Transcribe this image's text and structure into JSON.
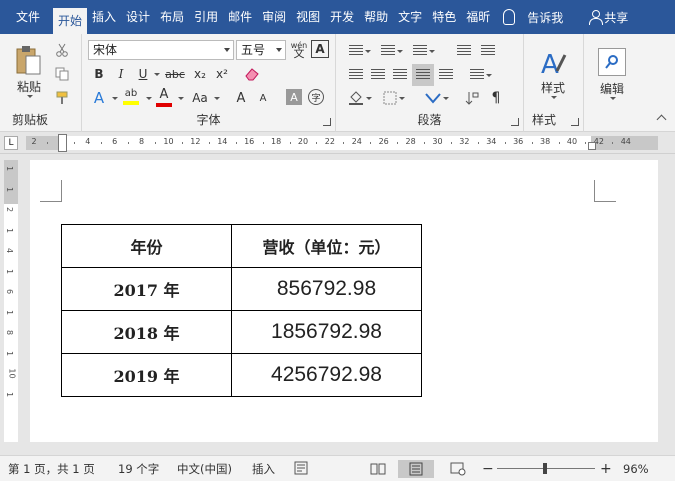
{
  "tabs": [
    {
      "label": "文件",
      "active": false
    },
    {
      "label": "开始",
      "active": true
    },
    {
      "label": "插入",
      "active": false
    },
    {
      "label": "设计",
      "active": false
    },
    {
      "label": "布局",
      "active": false
    },
    {
      "label": "引用",
      "active": false
    },
    {
      "label": "邮件",
      "active": false
    },
    {
      "label": "审阅",
      "active": false
    },
    {
      "label": "视图",
      "active": false
    },
    {
      "label": "开发",
      "active": false
    },
    {
      "label": "帮助",
      "active": false
    },
    {
      "label": "文字",
      "active": false
    },
    {
      "label": "特色",
      "active": false
    },
    {
      "label": "福昕",
      "active": false
    }
  ],
  "tell_me": "告诉我",
  "share": "共享",
  "ribbon": {
    "clipboard": {
      "label": "剪贴板",
      "paste": "粘贴"
    },
    "font": {
      "label": "字体",
      "font_name": "宋体",
      "font_size": "五号",
      "bold": "B",
      "italic": "I",
      "underline": "U",
      "strike": "abc",
      "subscript": "x₂",
      "superscript": "x²",
      "text_effect": "A",
      "highlight": "ab",
      "font_color": "A",
      "change_case": "Aa",
      "grow": "A",
      "shrink": "A",
      "char_shading": "A",
      "enclose": "字",
      "phonetic": "wén",
      "char_border": "A"
    },
    "paragraph": {
      "label": "段落"
    },
    "styles": {
      "label": "样式",
      "button": "样式"
    },
    "editing": {
      "button": "编辑"
    }
  },
  "ruler": {
    "corner": "L",
    "ticks": [
      "2",
      "2",
      "4",
      "6",
      "8",
      "10",
      "12",
      "14",
      "16",
      "18",
      "20",
      "22",
      "24",
      "26",
      "28",
      "30",
      "32",
      "34",
      "36",
      "38",
      "40",
      "42",
      "44"
    ],
    "vticks": [
      "1",
      "1",
      "2",
      "1",
      "4",
      "1",
      "6",
      "1",
      "8",
      "1",
      "10",
      "1"
    ]
  },
  "table": {
    "headers": [
      "年份",
      "营收（单位：元）"
    ],
    "rows": [
      [
        "2017 年",
        "856792.98"
      ],
      [
        "2018 年",
        "1856792.98"
      ],
      [
        "2019 年",
        "4256792.98"
      ]
    ]
  },
  "status": {
    "page": "第 1 页，共 1 页",
    "words": "19 个字",
    "language": "中文(中国)",
    "mode": "插入",
    "zoom_minus": "−",
    "zoom_plus": "+",
    "zoom": "96%",
    "zoom_level_percent": 96
  }
}
